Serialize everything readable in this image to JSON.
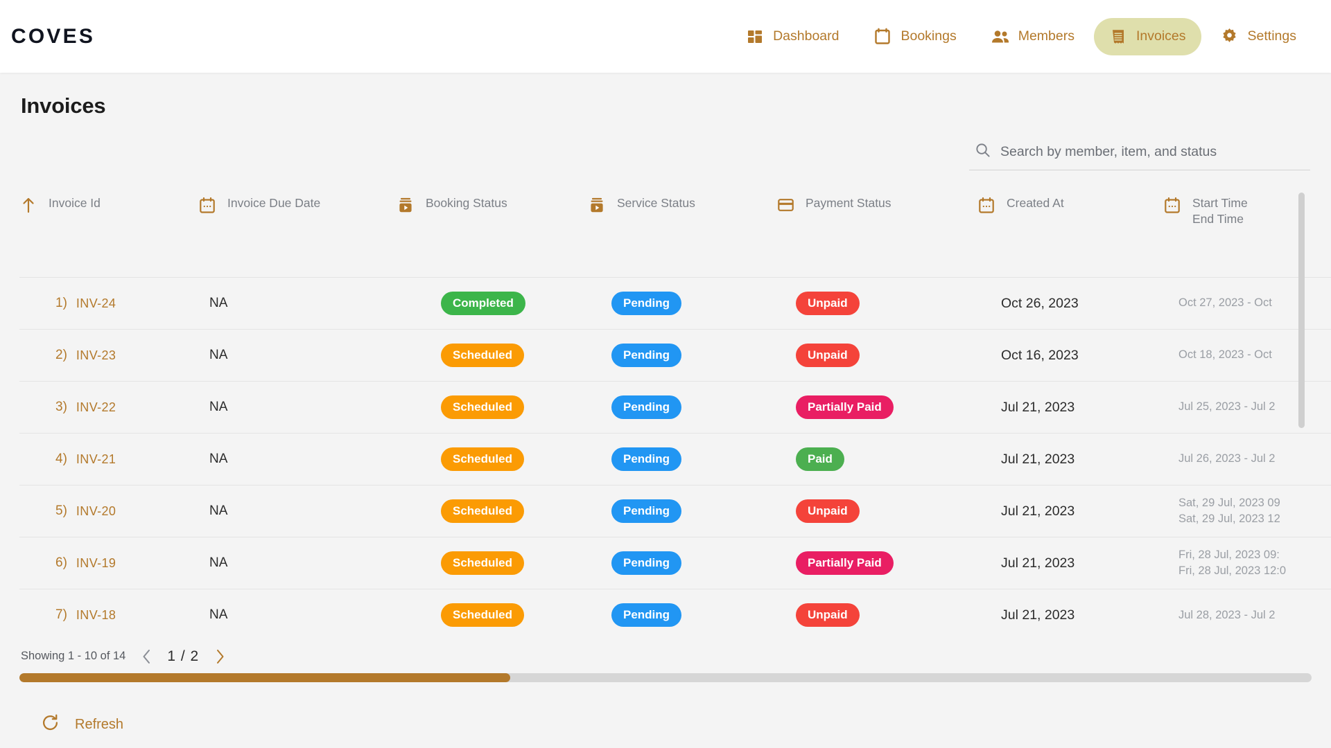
{
  "brand": "COVES",
  "nav": {
    "items": [
      {
        "label": "Dashboard",
        "icon": "dashboard-icon",
        "active": false
      },
      {
        "label": "Bookings",
        "icon": "calendar-icon",
        "active": false
      },
      {
        "label": "Members",
        "icon": "people-icon",
        "active": false
      },
      {
        "label": "Invoices",
        "icon": "receipt-icon",
        "active": true
      },
      {
        "label": "Settings",
        "icon": "gear-icon",
        "active": false
      }
    ]
  },
  "page": {
    "title": "Invoices"
  },
  "search": {
    "placeholder": "Search by member, item, and status",
    "value": "",
    "icon": "search-icon"
  },
  "table": {
    "columns": [
      {
        "label": "Invoice Id",
        "icon": "sort-arrow-up-icon"
      },
      {
        "label": "Invoice Due Date",
        "icon": "calendar-icon"
      },
      {
        "label": "Booking Status",
        "icon": "media-stack-icon"
      },
      {
        "label": "Service Status",
        "icon": "media-stack-icon"
      },
      {
        "label": "Payment Status",
        "icon": "credit-card-icon"
      },
      {
        "label": "Created At",
        "icon": "calendar-icon"
      },
      {
        "label": "Start Time\nEnd Time",
        "label_line1": "Start Time",
        "label_line2": "End Time",
        "icon": "calendar-icon"
      }
    ],
    "rows": [
      {
        "num": "1)",
        "invoice_id": "INV-24",
        "due_date": "NA",
        "booking_status": "Completed",
        "service_status": "Pending",
        "payment_status": "Unpaid",
        "created_at": "Oct 26, 2023",
        "time_line1": "Oct 27, 2023 - Oct",
        "time_line2": ""
      },
      {
        "num": "2)",
        "invoice_id": "INV-23",
        "due_date": "NA",
        "booking_status": "Scheduled",
        "service_status": "Pending",
        "payment_status": "Unpaid",
        "created_at": "Oct 16, 2023",
        "time_line1": "Oct 18, 2023 - Oct",
        "time_line2": ""
      },
      {
        "num": "3)",
        "invoice_id": "INV-22",
        "due_date": "NA",
        "booking_status": "Scheduled",
        "service_status": "Pending",
        "payment_status": "Partially Paid",
        "created_at": "Jul 21, 2023",
        "time_line1": "Jul 25, 2023 - Jul 2",
        "time_line2": ""
      },
      {
        "num": "4)",
        "invoice_id": "INV-21",
        "due_date": "NA",
        "booking_status": "Scheduled",
        "service_status": "Pending",
        "payment_status": "Paid",
        "created_at": "Jul 21, 2023",
        "time_line1": "Jul 26, 2023 - Jul 2",
        "time_line2": ""
      },
      {
        "num": "5)",
        "invoice_id": "INV-20",
        "due_date": "NA",
        "booking_status": "Scheduled",
        "service_status": "Pending",
        "payment_status": "Unpaid",
        "created_at": "Jul 21, 2023",
        "time_line1": "Sat, 29 Jul, 2023 09",
        "time_line2": "Sat, 29 Jul, 2023 12"
      },
      {
        "num": "6)",
        "invoice_id": "INV-19",
        "due_date": "NA",
        "booking_status": "Scheduled",
        "service_status": "Pending",
        "payment_status": "Partially Paid",
        "created_at": "Jul 21, 2023",
        "time_line1": "Fri, 28 Jul, 2023 09:",
        "time_line2": "Fri, 28 Jul, 2023 12:0"
      },
      {
        "num": "7)",
        "invoice_id": "INV-18",
        "due_date": "NA",
        "booking_status": "Scheduled",
        "service_status": "Pending",
        "payment_status": "Unpaid",
        "created_at": "Jul 21, 2023",
        "time_line1": "Jul 28, 2023 - Jul 2",
        "time_line2": ""
      }
    ]
  },
  "pagination": {
    "showing": "Showing 1 - 10  of 14",
    "page_indicator": "1 / 2",
    "prev_icon": "chevron-left-icon",
    "next_icon": "chevron-right-icon",
    "prev_enabled": false,
    "next_enabled": true,
    "hscroll_percent": 38
  },
  "refresh": {
    "label": "Refresh",
    "icon": "refresh-icon"
  },
  "colors": {
    "brand_accent": "#b3792b",
    "nav_active_bg": "#dfdfac",
    "status_completed": "#3cb54a",
    "status_scheduled": "#fb9b04",
    "status_pending": "#2196f3",
    "status_unpaid": "#f4433a",
    "status_partially_paid": "#e91e63",
    "status_paid": "#4caf50",
    "page_bg": "#f4f4f4",
    "scrollbar_thumb": "#b3792b"
  }
}
